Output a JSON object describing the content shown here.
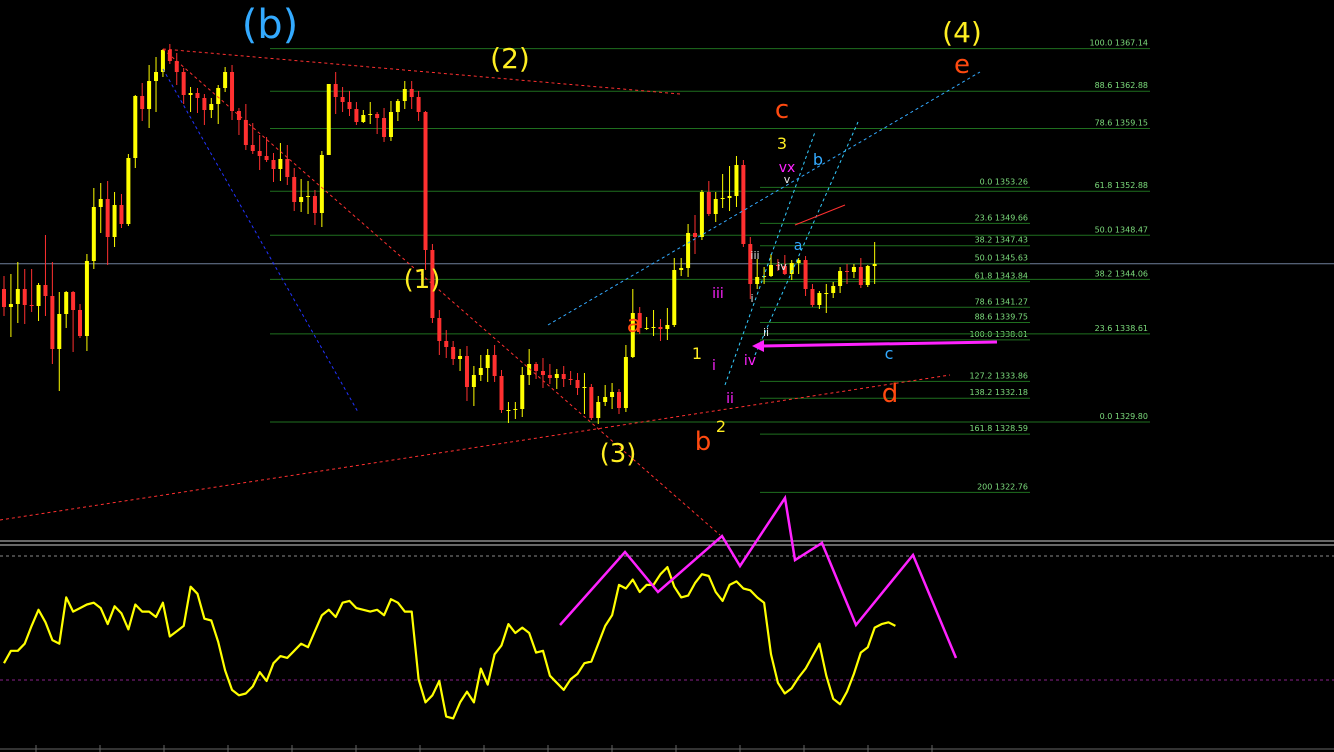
{
  "chart_data": {
    "type": "candlestick",
    "title": "",
    "colors": {
      "background": "#000000",
      "candle_up": "#ffff00",
      "candle_down": "#ff3030",
      "fib_line": "#1f6f1f",
      "fib_text": "#7cdc7c",
      "oscillator": "#ffff00",
      "magenta": "#ff22ff",
      "blue_label": "#33aaff",
      "orange_label": "#ff4a10",
      "yellow_label": "#ffee22"
    },
    "price_axis_range": [
      1318,
      1372
    ],
    "current_price": 1345.63,
    "fib_levels": [
      {
        "label": "100.0",
        "value": "1367.14"
      },
      {
        "label": "88.6",
        "value": "1362.88"
      },
      {
        "label": "78.6",
        "value": "1359.15"
      },
      {
        "label": "0.0",
        "value": "1353.26"
      },
      {
        "label": "61.8",
        "value": "1352.88"
      },
      {
        "label": "23.6",
        "value": "1349.66"
      },
      {
        "label": "50.0",
        "value": "1348.47"
      },
      {
        "label": "38.2",
        "value": "1347.43"
      },
      {
        "label": "50.0",
        "value": "1345.63"
      },
      {
        "label": "61.8",
        "value": "1343.84"
      },
      {
        "label": "38.2",
        "value": "1344.06"
      },
      {
        "label": "78.6",
        "value": "1341.27"
      },
      {
        "label": "88.6",
        "value": "1339.75"
      },
      {
        "label": "100.0",
        "value": "1338.01"
      },
      {
        "label": "23.6",
        "value": "1338.61"
      },
      {
        "label": "127.2",
        "value": "1333.86"
      },
      {
        "label": "138.2",
        "value": "1332.18"
      },
      {
        "label": "0.0",
        "value": "1329.80"
      },
      {
        "label": "161.8",
        "value": "1328.59"
      },
      {
        "label": "200",
        "value": "1322.76"
      }
    ],
    "wave_labels": [
      {
        "text": "(b)",
        "color": "blue"
      },
      {
        "text": "(2)",
        "color": "yellow"
      },
      {
        "text": "(1)",
        "color": "yellow"
      },
      {
        "text": "(3)",
        "color": "yellow"
      },
      {
        "text": "(4)",
        "color": "yellow"
      },
      {
        "text": "a",
        "color": "orange"
      },
      {
        "text": "b",
        "color": "orange"
      },
      {
        "text": "c",
        "color": "orange"
      },
      {
        "text": "d",
        "color": "orange"
      },
      {
        "text": "e",
        "color": "orange"
      },
      {
        "text": "1",
        "color": "yellow"
      },
      {
        "text": "2",
        "color": "yellow"
      },
      {
        "text": "3",
        "color": "yellow"
      },
      {
        "text": "i",
        "color": "magenta"
      },
      {
        "text": "ii",
        "color": "magenta"
      },
      {
        "text": "iii",
        "color": "magenta"
      },
      {
        "text": "iv",
        "color": "magenta"
      },
      {
        "text": "vx",
        "color": "magenta"
      },
      {
        "text": "i",
        "color": "white"
      },
      {
        "text": "ii",
        "color": "white"
      },
      {
        "text": "iii",
        "color": "white"
      },
      {
        "text": "iv",
        "color": "white"
      },
      {
        "text": "v",
        "color": "white"
      },
      {
        "text": "a",
        "color": "blue"
      },
      {
        "text": "b",
        "color": "blue"
      },
      {
        "text": "c",
        "color": "blue"
      }
    ],
    "series": [
      {
        "type": "candles",
        "ohlc": [
          [
            1343.1,
            1344.4,
            1340.4,
            1341.3
          ],
          [
            1341.3,
            1344.6,
            1338.3,
            1341.6
          ],
          [
            1341.6,
            1345.8,
            1339.7,
            1343.1
          ],
          [
            1343.1,
            1345.1,
            1339.6,
            1341.5
          ],
          [
            1341.5,
            1345.1,
            1340.8,
            1341.4
          ],
          [
            1341.4,
            1343.7,
            1339.9,
            1343.5
          ],
          [
            1343.5,
            1348.5,
            1340.4,
            1342.4
          ],
          [
            1342.4,
            1345.8,
            1335.6,
            1337.1
          ],
          [
            1337.1,
            1342.8,
            1332.9,
            1340.6
          ],
          [
            1340.6,
            1342.9,
            1339.2,
            1342.8
          ],
          [
            1342.8,
            1342.9,
            1336.8,
            1341.0
          ],
          [
            1341.0,
            1341.6,
            1338.2,
            1338.4
          ],
          [
            1338.4,
            1346.6,
            1336.9,
            1345.9
          ],
          [
            1345.9,
            1353.2,
            1345.1,
            1351.3
          ],
          [
            1351.3,
            1353.7,
            1348.7,
            1352.1
          ],
          [
            1352.1,
            1353.9,
            1345.5,
            1348.3
          ],
          [
            1348.3,
            1352.8,
            1347.3,
            1351.5
          ],
          [
            1351.5,
            1352.6,
            1349.2,
            1349.6
          ],
          [
            1349.6,
            1356.6,
            1349.4,
            1356.2
          ],
          [
            1356.2,
            1362.5,
            1355.2,
            1362.4
          ],
          [
            1362.4,
            1363.7,
            1359.9,
            1361.1
          ],
          [
            1361.1,
            1365.5,
            1359.2,
            1363.9
          ],
          [
            1363.9,
            1366.3,
            1360.8,
            1364.8
          ],
          [
            1364.8,
            1367.1,
            1364.3,
            1367.0
          ],
          [
            1367.0,
            1367.6,
            1365.6,
            1365.9
          ],
          [
            1365.9,
            1366.7,
            1363.5,
            1364.8
          ],
          [
            1364.8,
            1365.2,
            1361.6,
            1362.5
          ],
          [
            1362.5,
            1363.3,
            1360.8,
            1362.7
          ],
          [
            1362.7,
            1363.2,
            1360.7,
            1362.2
          ],
          [
            1362.2,
            1362.6,
            1359.5,
            1361.0
          ],
          [
            1361.0,
            1362.2,
            1360.2,
            1361.6
          ],
          [
            1361.6,
            1363.5,
            1359.6,
            1363.2
          ],
          [
            1363.2,
            1365.3,
            1362.8,
            1364.8
          ],
          [
            1364.8,
            1365.5,
            1360.0,
            1360.9
          ],
          [
            1360.9,
            1361.2,
            1358.5,
            1360.0
          ],
          [
            1360.0,
            1361.6,
            1357.0,
            1357.5
          ],
          [
            1357.5,
            1359.7,
            1356.6,
            1356.9
          ],
          [
            1356.9,
            1358.5,
            1355.0,
            1356.4
          ],
          [
            1356.4,
            1358.3,
            1355.8,
            1356.0
          ],
          [
            1356.0,
            1356.7,
            1353.8,
            1355.1
          ],
          [
            1355.1,
            1357.7,
            1353.9,
            1356.1
          ],
          [
            1356.1,
            1357.5,
            1353.5,
            1354.3
          ],
          [
            1354.3,
            1355.2,
            1350.9,
            1351.8
          ],
          [
            1351.8,
            1354.1,
            1350.8,
            1352.3
          ],
          [
            1352.3,
            1353.9,
            1350.6,
            1352.4
          ],
          [
            1352.4,
            1353.0,
            1349.5,
            1350.7
          ],
          [
            1350.7,
            1356.9,
            1349.3,
            1356.5
          ],
          [
            1356.5,
            1363.6,
            1356.5,
            1363.6
          ],
          [
            1363.6,
            1364.8,
            1360.6,
            1362.3
          ],
          [
            1362.3,
            1363.3,
            1360.8,
            1361.8
          ],
          [
            1361.8,
            1362.9,
            1360.4,
            1361.1
          ],
          [
            1361.1,
            1361.8,
            1359.5,
            1359.8
          ],
          [
            1359.8,
            1361.0,
            1359.7,
            1360.5
          ],
          [
            1360.5,
            1361.8,
            1359.6,
            1360.6
          ],
          [
            1360.6,
            1360.8,
            1358.6,
            1360.2
          ],
          [
            1360.2,
            1361.2,
            1357.8,
            1358.3
          ],
          [
            1358.3,
            1361.9,
            1357.9,
            1360.8
          ],
          [
            1360.8,
            1362.1,
            1359.9,
            1361.9
          ],
          [
            1361.9,
            1363.9,
            1361.1,
            1363.1
          ],
          [
            1363.1,
            1363.9,
            1361.1,
            1362.3
          ],
          [
            1362.3,
            1362.9,
            1359.9,
            1360.8
          ],
          [
            1360.8,
            1360.9,
            1345.0,
            1347.0
          ],
          [
            1347.0,
            1347.6,
            1339.7,
            1340.2
          ],
          [
            1340.2,
            1341.0,
            1336.5,
            1337.9
          ],
          [
            1337.9,
            1339.0,
            1336.2,
            1337.3
          ],
          [
            1337.3,
            1337.9,
            1335.5,
            1336.1
          ],
          [
            1336.1,
            1337.1,
            1334.9,
            1336.4
          ],
          [
            1336.4,
            1337.4,
            1331.9,
            1333.3
          ],
          [
            1333.3,
            1335.4,
            1331.4,
            1334.5
          ],
          [
            1334.5,
            1336.5,
            1333.9,
            1335.2
          ],
          [
            1335.2,
            1337.1,
            1333.8,
            1336.5
          ],
          [
            1336.5,
            1337.5,
            1333.8,
            1334.4
          ],
          [
            1334.4,
            1335.0,
            1330.7,
            1331.0
          ],
          [
            1331.0,
            1331.8,
            1329.7,
            1331.0
          ],
          [
            1331.0,
            1331.8,
            1330.1,
            1331.1
          ],
          [
            1331.1,
            1335.3,
            1330.3,
            1334.5
          ],
          [
            1334.5,
            1337.1,
            1333.5,
            1335.6
          ],
          [
            1335.6,
            1335.8,
            1334.1,
            1334.9
          ],
          [
            1334.9,
            1336.2,
            1333.2,
            1334.5
          ],
          [
            1334.5,
            1335.6,
            1333.6,
            1334.2
          ],
          [
            1334.2,
            1335.1,
            1333.1,
            1334.6
          ],
          [
            1334.6,
            1335.4,
            1333.3,
            1334.1
          ],
          [
            1334.1,
            1334.9,
            1333.5,
            1334.0
          ],
          [
            1334.0,
            1334.7,
            1332.5,
            1333.2
          ],
          [
            1333.2,
            1334.7,
            1330.6,
            1333.3
          ],
          [
            1333.3,
            1333.6,
            1330.0,
            1330.2
          ],
          [
            1330.2,
            1332.4,
            1329.6,
            1331.8
          ],
          [
            1331.8,
            1333.5,
            1331.4,
            1332.3
          ],
          [
            1332.3,
            1333.7,
            1331.1,
            1332.8
          ],
          [
            1332.8,
            1333.1,
            1330.6,
            1331.2
          ],
          [
            1331.2,
            1337.5,
            1330.8,
            1336.3
          ],
          [
            1336.3,
            1343.1,
            1336.2,
            1340.7
          ],
          [
            1340.7,
            1341.3,
            1338.6,
            1339.2
          ],
          [
            1339.2,
            1340.3,
            1339.0,
            1339.2
          ],
          [
            1339.2,
            1341.0,
            1338.4,
            1339.3
          ],
          [
            1339.3,
            1340.1,
            1337.9,
            1339.1
          ],
          [
            1339.1,
            1341.2,
            1338.0,
            1339.5
          ],
          [
            1339.5,
            1346.2,
            1339.3,
            1345.0
          ],
          [
            1345.0,
            1346.2,
            1344.4,
            1345.2
          ],
          [
            1345.2,
            1349.6,
            1344.3,
            1348.7
          ],
          [
            1348.7,
            1350.5,
            1346.6,
            1348.3
          ],
          [
            1348.3,
            1353.0,
            1348.0,
            1352.8
          ],
          [
            1352.8,
            1353.9,
            1350.4,
            1350.6
          ],
          [
            1350.6,
            1352.8,
            1349.8,
            1352.1
          ],
          [
            1352.1,
            1354.6,
            1351.2,
            1352.2
          ],
          [
            1352.2,
            1355.4,
            1350.9,
            1352.4
          ],
          [
            1352.4,
            1356.4,
            1351.3,
            1355.5
          ],
          [
            1355.5,
            1356.0,
            1347.3,
            1347.6
          ],
          [
            1347.6,
            1348.3,
            1342.1,
            1343.6
          ],
          [
            1343.6,
            1346.1,
            1343.1,
            1344.3
          ],
          [
            1344.3,
            1345.3,
            1343.6,
            1344.4
          ],
          [
            1344.4,
            1346.6,
            1344.3,
            1345.5
          ],
          [
            1345.5,
            1346.1,
            1344.9,
            1345.4
          ],
          [
            1345.4,
            1346.5,
            1344.5,
            1344.6
          ],
          [
            1344.6,
            1346.0,
            1344.0,
            1345.7
          ],
          [
            1345.7,
            1346.2,
            1344.6,
            1346.0
          ],
          [
            1346.0,
            1346.4,
            1342.4,
            1343.1
          ],
          [
            1343.1,
            1343.6,
            1341.3,
            1341.5
          ],
          [
            1341.5,
            1342.9,
            1341.1,
            1342.7
          ],
          [
            1342.7,
            1343.6,
            1340.7,
            1342.7
          ],
          [
            1342.7,
            1343.8,
            1342.2,
            1343.4
          ],
          [
            1343.4,
            1345.3,
            1342.7,
            1344.9
          ],
          [
            1344.9,
            1345.6,
            1343.6,
            1344.8
          ],
          [
            1344.8,
            1345.6,
            1344.2,
            1345.3
          ],
          [
            1345.3,
            1346.2,
            1343.2,
            1343.5
          ],
          [
            1343.5,
            1345.5,
            1343.3,
            1345.4
          ],
          [
            1345.4,
            1347.8,
            1343.6,
            1345.6
          ]
        ]
      },
      {
        "name": "",
        "type": "oscillator-line",
        "values": [
          42,
          49,
          49,
          53,
          63,
          72,
          65,
          55,
          53,
          79,
          71,
          73,
          75,
          76,
          73,
          64,
          74,
          70,
          61,
          75,
          71,
          71,
          68,
          76,
          57,
          60,
          63,
          85,
          81,
          67,
          66,
          54,
          38,
          27,
          24,
          25,
          29,
          37,
          32,
          42,
          46,
          45,
          49,
          53,
          51,
          60,
          69,
          72,
          68,
          76,
          77,
          73,
          72,
          71,
          72,
          69,
          78,
          76,
          71,
          71,
          33,
          20,
          24,
          32,
          12,
          11,
          20,
          26,
          20,
          39,
          30,
          47,
          52,
          64,
          59,
          62,
          59,
          48,
          49,
          35,
          31,
          27,
          33,
          36,
          42,
          43,
          53,
          63,
          69,
          86,
          84,
          89,
          82,
          86,
          86,
          92,
          96,
          85,
          79,
          80,
          87,
          92,
          91,
          82,
          77,
          86,
          88,
          84,
          83,
          79,
          76,
          47,
          31,
          25,
          28,
          34,
          39,
          46,
          53,
          35,
          22,
          19,
          26,
          36,
          48,
          51,
          62,
          64,
          65,
          63
        ]
      }
    ]
  }
}
